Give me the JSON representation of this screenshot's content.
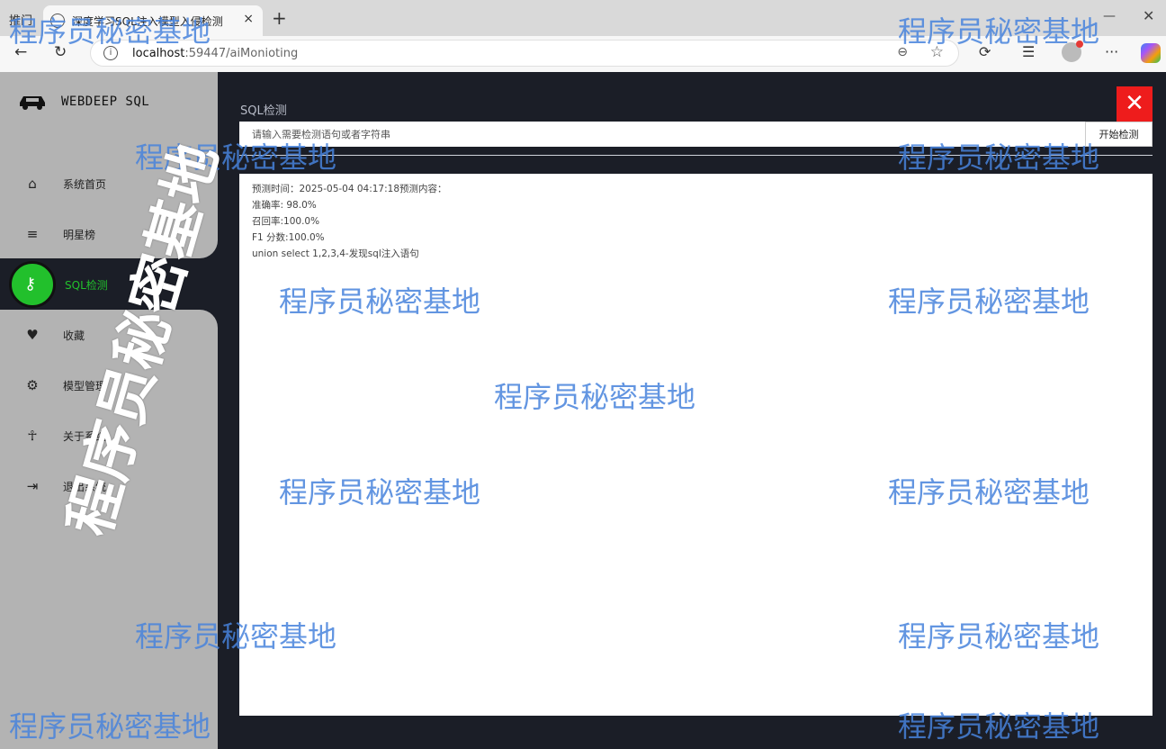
{
  "browser": {
    "prev_tab_label": "推门",
    "tab_title": "深度学习SQL注入模型入侵检测",
    "tab_close": "×",
    "new_tab": "+",
    "url_host": "localhost",
    "url_rest": ":59447/aiMonioting",
    "win_min": "—",
    "win_close": "✕"
  },
  "sidebar": {
    "brand": "WEBDEEP SQL",
    "items": [
      {
        "label": "系统首页",
        "icon": "home-icon"
      },
      {
        "label": "明星榜",
        "icon": "list-icon"
      },
      {
        "label": "SQL检测",
        "icon": "key-icon"
      },
      {
        "label": "收藏",
        "icon": "heart-icon"
      },
      {
        "label": "模型管理",
        "icon": "gear-icon"
      },
      {
        "label": "关于系统",
        "icon": "person-icon"
      },
      {
        "label": "退出系统",
        "icon": "logout-icon"
      }
    ]
  },
  "main": {
    "title": "SQL检测",
    "close_label": "✕",
    "search_placeholder": "请输入需要检测语句或者字符串",
    "detect_button": "开始检测",
    "results": [
      "预测时间：2025-05-04 04:17:18预测内容：",
      "准确率: 98.0%",
      "召回率:100.0%",
      "F1 分数:100.0%",
      "union select 1,2,3,4-发现sql注入语句"
    ]
  },
  "watermark": {
    "text": "程序员秘密基地",
    "big_text": "程序员秘密基地"
  },
  "colors": {
    "active": "#22c02c",
    "close_red": "#ee1c1c",
    "watermark": "#4682dc"
  }
}
